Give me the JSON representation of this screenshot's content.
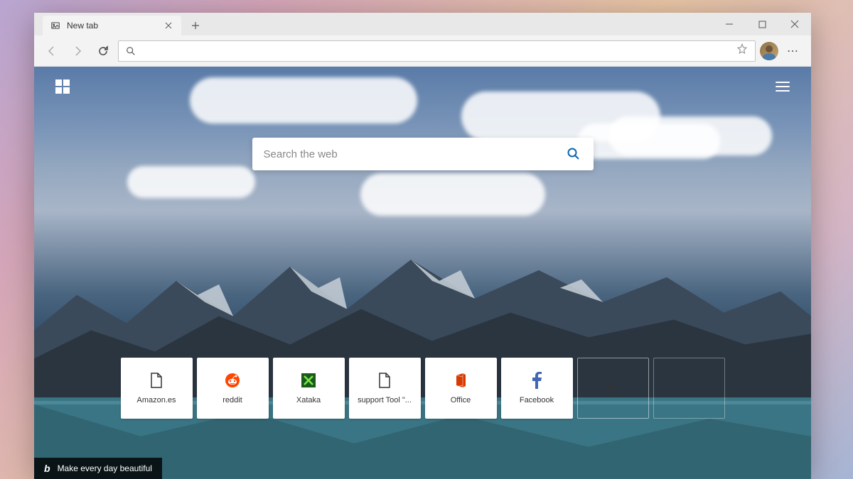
{
  "tab": {
    "title": "New tab"
  },
  "addressbar": {
    "value": ""
  },
  "search": {
    "placeholder": "Search the web"
  },
  "tiles": [
    {
      "label": "Amazon.es",
      "icon": "file"
    },
    {
      "label": "reddit",
      "icon": "reddit"
    },
    {
      "label": "Xataka",
      "icon": "xataka"
    },
    {
      "label": "support Tool \"...",
      "icon": "file"
    },
    {
      "label": "Office",
      "icon": "office"
    },
    {
      "label": "Facebook",
      "icon": "facebook"
    }
  ],
  "bing_caption": "Make every day beautiful",
  "colors": {
    "accent": "#0b66b5",
    "reddit": "#ff4500",
    "xataka": "#2a8a2a",
    "office": "#d83b01",
    "facebook": "#4267b2"
  }
}
